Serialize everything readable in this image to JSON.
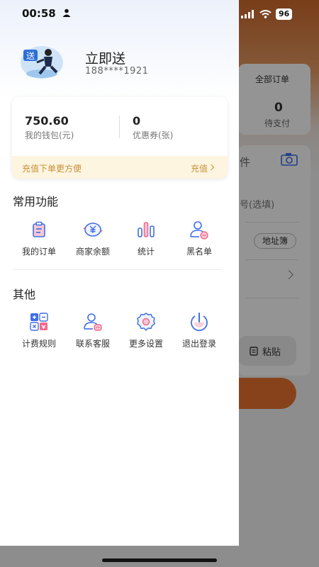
{
  "status_bar": {
    "time": "00:58",
    "battery": "96"
  },
  "background": {
    "all_orders": "全部订单",
    "pending_count": "0",
    "pending_payment": "待支付",
    "fragment_1": "件",
    "fragment_2": "号(选填)",
    "address_book": "地址簿",
    "paste": "粘贴"
  },
  "profile": {
    "name": "立即送",
    "phone": "188****1921",
    "avatar_text": "送"
  },
  "wallet": {
    "balance": "750.60",
    "balance_label": "我的钱包(元)",
    "coupons": "0",
    "coupons_label": "优惠券(张)",
    "recharge_tip": "充值下单更方便",
    "recharge_link": "充值"
  },
  "common": {
    "title": "常用功能",
    "items": [
      {
        "label": "我的订单",
        "icon": "order-icon"
      },
      {
        "label": "商家余额",
        "icon": "balance-icon"
      },
      {
        "label": "统计",
        "icon": "stats-icon"
      },
      {
        "label": "黑名单",
        "icon": "blacklist-icon"
      }
    ]
  },
  "other": {
    "title": "其他",
    "items": [
      {
        "label": "计费规则",
        "icon": "calculator-icon"
      },
      {
        "label": "联系客服",
        "icon": "customer-service-icon"
      },
      {
        "label": "更多设置",
        "icon": "settings-icon"
      },
      {
        "label": "退出登录",
        "icon": "logout-icon"
      }
    ]
  },
  "colors": {
    "accent_blue": "#3f6ee8",
    "accent_orange": "#e8722f",
    "accent_pink": "#f06b8a",
    "gold": "#c8913a"
  }
}
